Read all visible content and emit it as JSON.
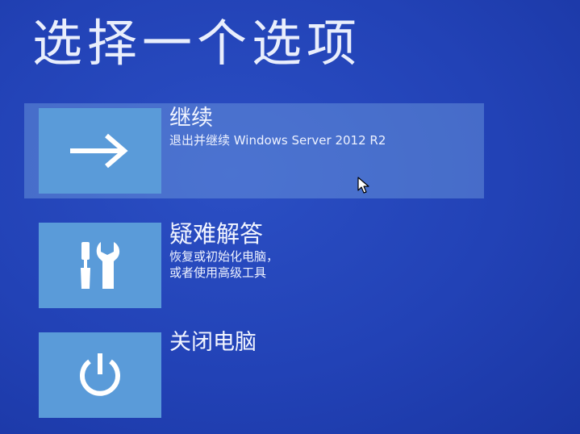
{
  "header": {
    "title": "选择一个选项"
  },
  "options": [
    {
      "title": "继续",
      "description": "退出并继续 Windows Server 2012 R2",
      "icon": "arrow-right-icon"
    },
    {
      "title": "疑难解答",
      "description_line1": "恢复或初始化电脑，",
      "description_line2": "或者使用高级工具",
      "icon": "tools-icon"
    },
    {
      "title": "关闭电脑",
      "icon": "power-icon"
    }
  ],
  "colors": {
    "background": "#2242b6",
    "tile": "#5a9bd9",
    "selected_highlight": "#74a0e0",
    "text": "#ffffff"
  }
}
